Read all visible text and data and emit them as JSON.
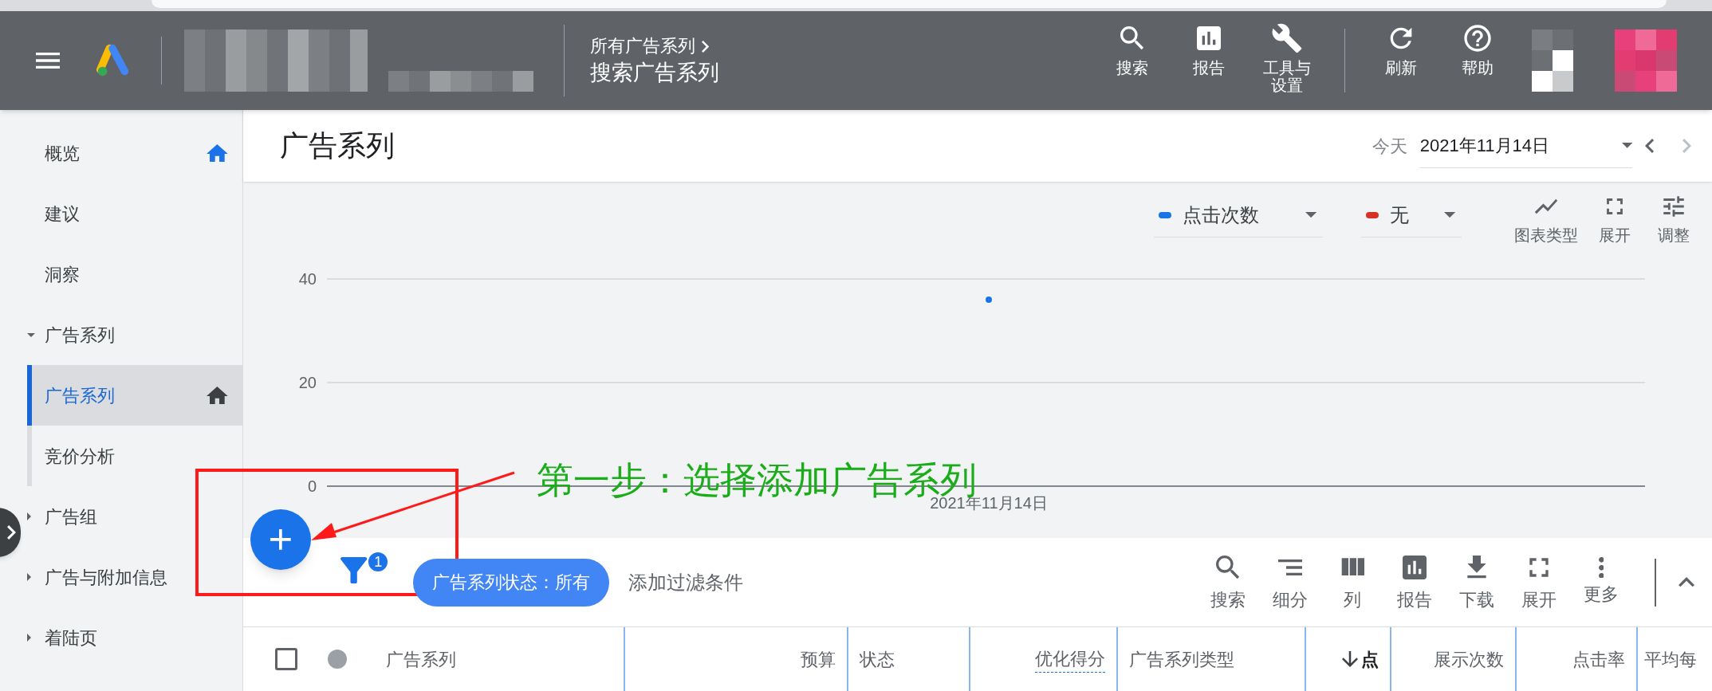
{
  "header": {
    "breadcrumb": "所有广告系列",
    "title": "搜索广告系列",
    "actions": [
      {
        "label": "搜索",
        "kind": "search"
      },
      {
        "label": "报告",
        "kind": "report"
      },
      {
        "label": "工具与设置",
        "kind": "tools"
      },
      {
        "label": "刷新",
        "kind": "refresh"
      },
      {
        "label": "帮助",
        "kind": "help"
      }
    ]
  },
  "sidebar": {
    "items": [
      {
        "label": "概览",
        "selected": false,
        "home_icon": true
      },
      {
        "label": "建议",
        "selected": false
      },
      {
        "label": "洞察",
        "selected": false
      },
      {
        "label": "广告系列",
        "selected": false,
        "expanded": true,
        "children": [
          {
            "label": "广告系列",
            "selected": true,
            "home_icon": true
          },
          {
            "label": "竞价分析",
            "selected": false
          }
        ]
      },
      {
        "label": "广告组",
        "selected": false,
        "expanded": false
      },
      {
        "label": "广告与附加信息",
        "selected": false,
        "expanded": false
      },
      {
        "label": "着陆页",
        "selected": false,
        "expanded": false
      }
    ]
  },
  "page": {
    "title": "广告系列",
    "date_label": "今天",
    "date": "2021年11月14日"
  },
  "chart": {
    "metrics": [
      {
        "color": "#1a73e8"
      },
      {
        "label": "无",
        "color": "#d93025"
      }
    ],
    "tools": [
      {
        "label": "图表类型",
        "kind": "chart-type"
      },
      {
        "label": "展开",
        "kind": "expand"
      },
      {
        "label": "调整",
        "kind": "adjust"
      }
    ],
    "chart_data": {
      "type": "scatter",
      "x": [
        "2021年11月14日"
      ],
      "series": [
        {
          "name": "点击次数",
          "color": "#1a73e8",
          "values": [
            36
          ]
        }
      ],
      "ylim": [
        0,
        40
      ],
      "yticks": [
        0,
        20,
        40
      ]
    }
  },
  "table_toolbar": {
    "filter_count": "1",
    "filter_chip": "广告系列状态：所有",
    "add_filter": "添加过滤条件",
    "tools": [
      {
        "label": "搜索",
        "kind": "search"
      },
      {
        "label": "细分",
        "kind": "segment"
      },
      {
        "label": "列",
        "kind": "columns"
      },
      {
        "label": "报告",
        "kind": "report"
      },
      {
        "label": "下载",
        "kind": "download"
      },
      {
        "label": "展开",
        "kind": "expand"
      },
      {
        "label": "更多",
        "kind": "more"
      }
    ]
  },
  "table": {
    "select_all_checked": false,
    "columns": [
      {
        "label": "广告系列",
        "sorted": false
      },
      {
        "label": "预算",
        "sorted": false
      },
      {
        "label": "状态",
        "sorted": false
      },
      {
        "label": "优化得分",
        "sorted": false
      },
      {
        "label": "广告系列类型",
        "sorted": false
      },
      {
        "label": "点",
        "sorted": true
      },
      {
        "label": "展示次数",
        "sorted": false
      },
      {
        "label": "点击率",
        "sorted": false
      },
      {
        "label": "平均每",
        "sorted": false
      }
    ]
  },
  "annotation": {
    "text": "第一步：选择添加广告系列"
  }
}
